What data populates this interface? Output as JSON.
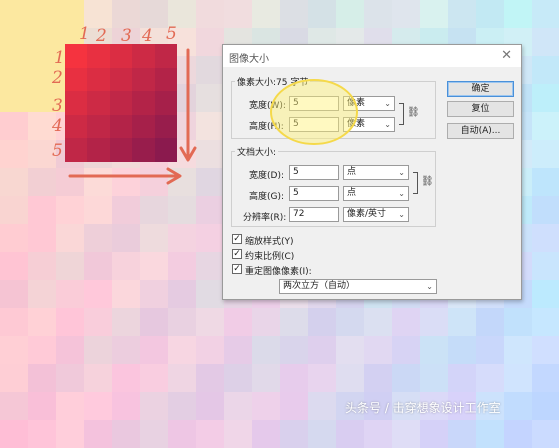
{
  "annotations": {
    "column_numbers": [
      "1",
      "2",
      "3",
      "4",
      "5"
    ],
    "row_numbers": [
      "1",
      "2",
      "3",
      "4",
      "5"
    ],
    "highlight_color": "#fff176",
    "ink_color": "#e26a54"
  },
  "dialog": {
    "title": "图像大小",
    "close_glyph": "✕",
    "pixel_dimensions": {
      "label": "像素大小:75 字节",
      "width_label": "宽度(W):",
      "width_value": "5",
      "width_unit": "像素",
      "height_label": "高度(H):",
      "height_value": "5",
      "height_unit": "像素"
    },
    "document_size": {
      "label": "文档大小:",
      "width_label": "宽度(D):",
      "width_value": "5",
      "width_unit": "点",
      "height_label": "高度(G):",
      "height_value": "5",
      "height_unit": "点",
      "resolution_label": "分辨率(R):",
      "resolution_value": "72",
      "resolution_unit": "像素/英寸"
    },
    "checkboxes": {
      "scale_styles": "缩放样式(Y)",
      "constrain": "约束比例(C)",
      "resample": "重定图像像素(I):"
    },
    "resample_method": "两次立方（自动）",
    "buttons": {
      "ok": "确定",
      "reset": "复位",
      "auto": "自动(A)..."
    }
  },
  "watermark": "头条号 / 击穿想象设计工作室",
  "colors": {
    "grid_top": "#f5333f",
    "grid_bottom": "#8b1a4e",
    "dialog_bg": "#f0f0f0",
    "accent": "#4a90d9"
  }
}
